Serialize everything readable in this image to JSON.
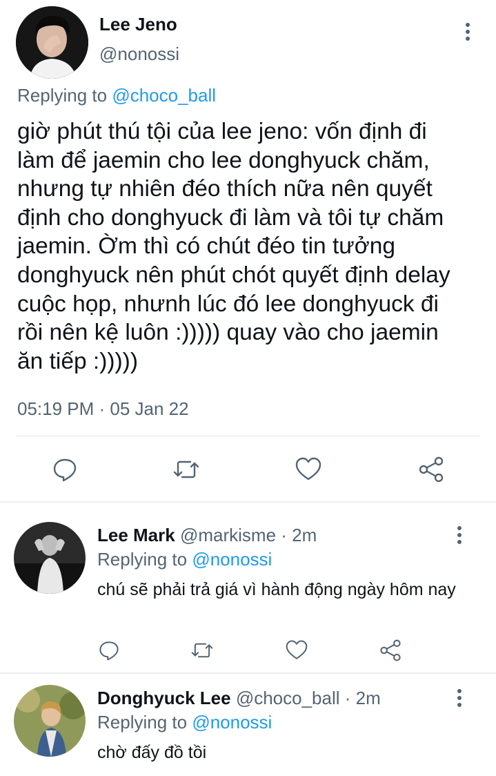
{
  "main_tweet": {
    "author_name": "Lee Jeno",
    "author_handle": "@nonossi",
    "replying_prefix": "Replying to",
    "replying_handle": "@choco_ball",
    "text": "giờ phút thú tội của lee jeno: vốn định đi\nlàm để jaemin cho lee donghyuck chăm,\nnhưng tự nhiên đéo thích nữa nên quyết\nđịnh cho donghyuck đi làm và tôi tự chăm\njaemin. Ờm thì có chút đéo tin tưởng\ndonghyuck nên phút chót quyết định delay\ncuộc họp, nhưnh lúc đó lee donghyuck đi\nrồi nên kệ luôn :))))) quay vào cho jaemin\năn tiếp :)))))",
    "timestamp": "05:19 PM · 05 Jan 22"
  },
  "actions": [
    "reply-icon",
    "retweet-icon",
    "like-icon",
    "share-icon"
  ],
  "replies": [
    {
      "author_name": "Lee Mark",
      "meta": "@markisme · 2m",
      "replying_prefix": "Replying to",
      "replying_handle": "@nonossi",
      "text": "chú sẽ phải trả giá vì hành động ngày hôm nay"
    },
    {
      "author_name": "Donghyuck Lee",
      "meta": "@choco_ball · 2m",
      "replying_prefix": "Replying to",
      "replying_handle": "@nonossi",
      "text": "chờ đấy đồ tồi"
    }
  ],
  "colors": {
    "text": "#0f1419",
    "secondary": "#536471",
    "link": "#1d9bf0",
    "divider": "#e1e6ea"
  }
}
